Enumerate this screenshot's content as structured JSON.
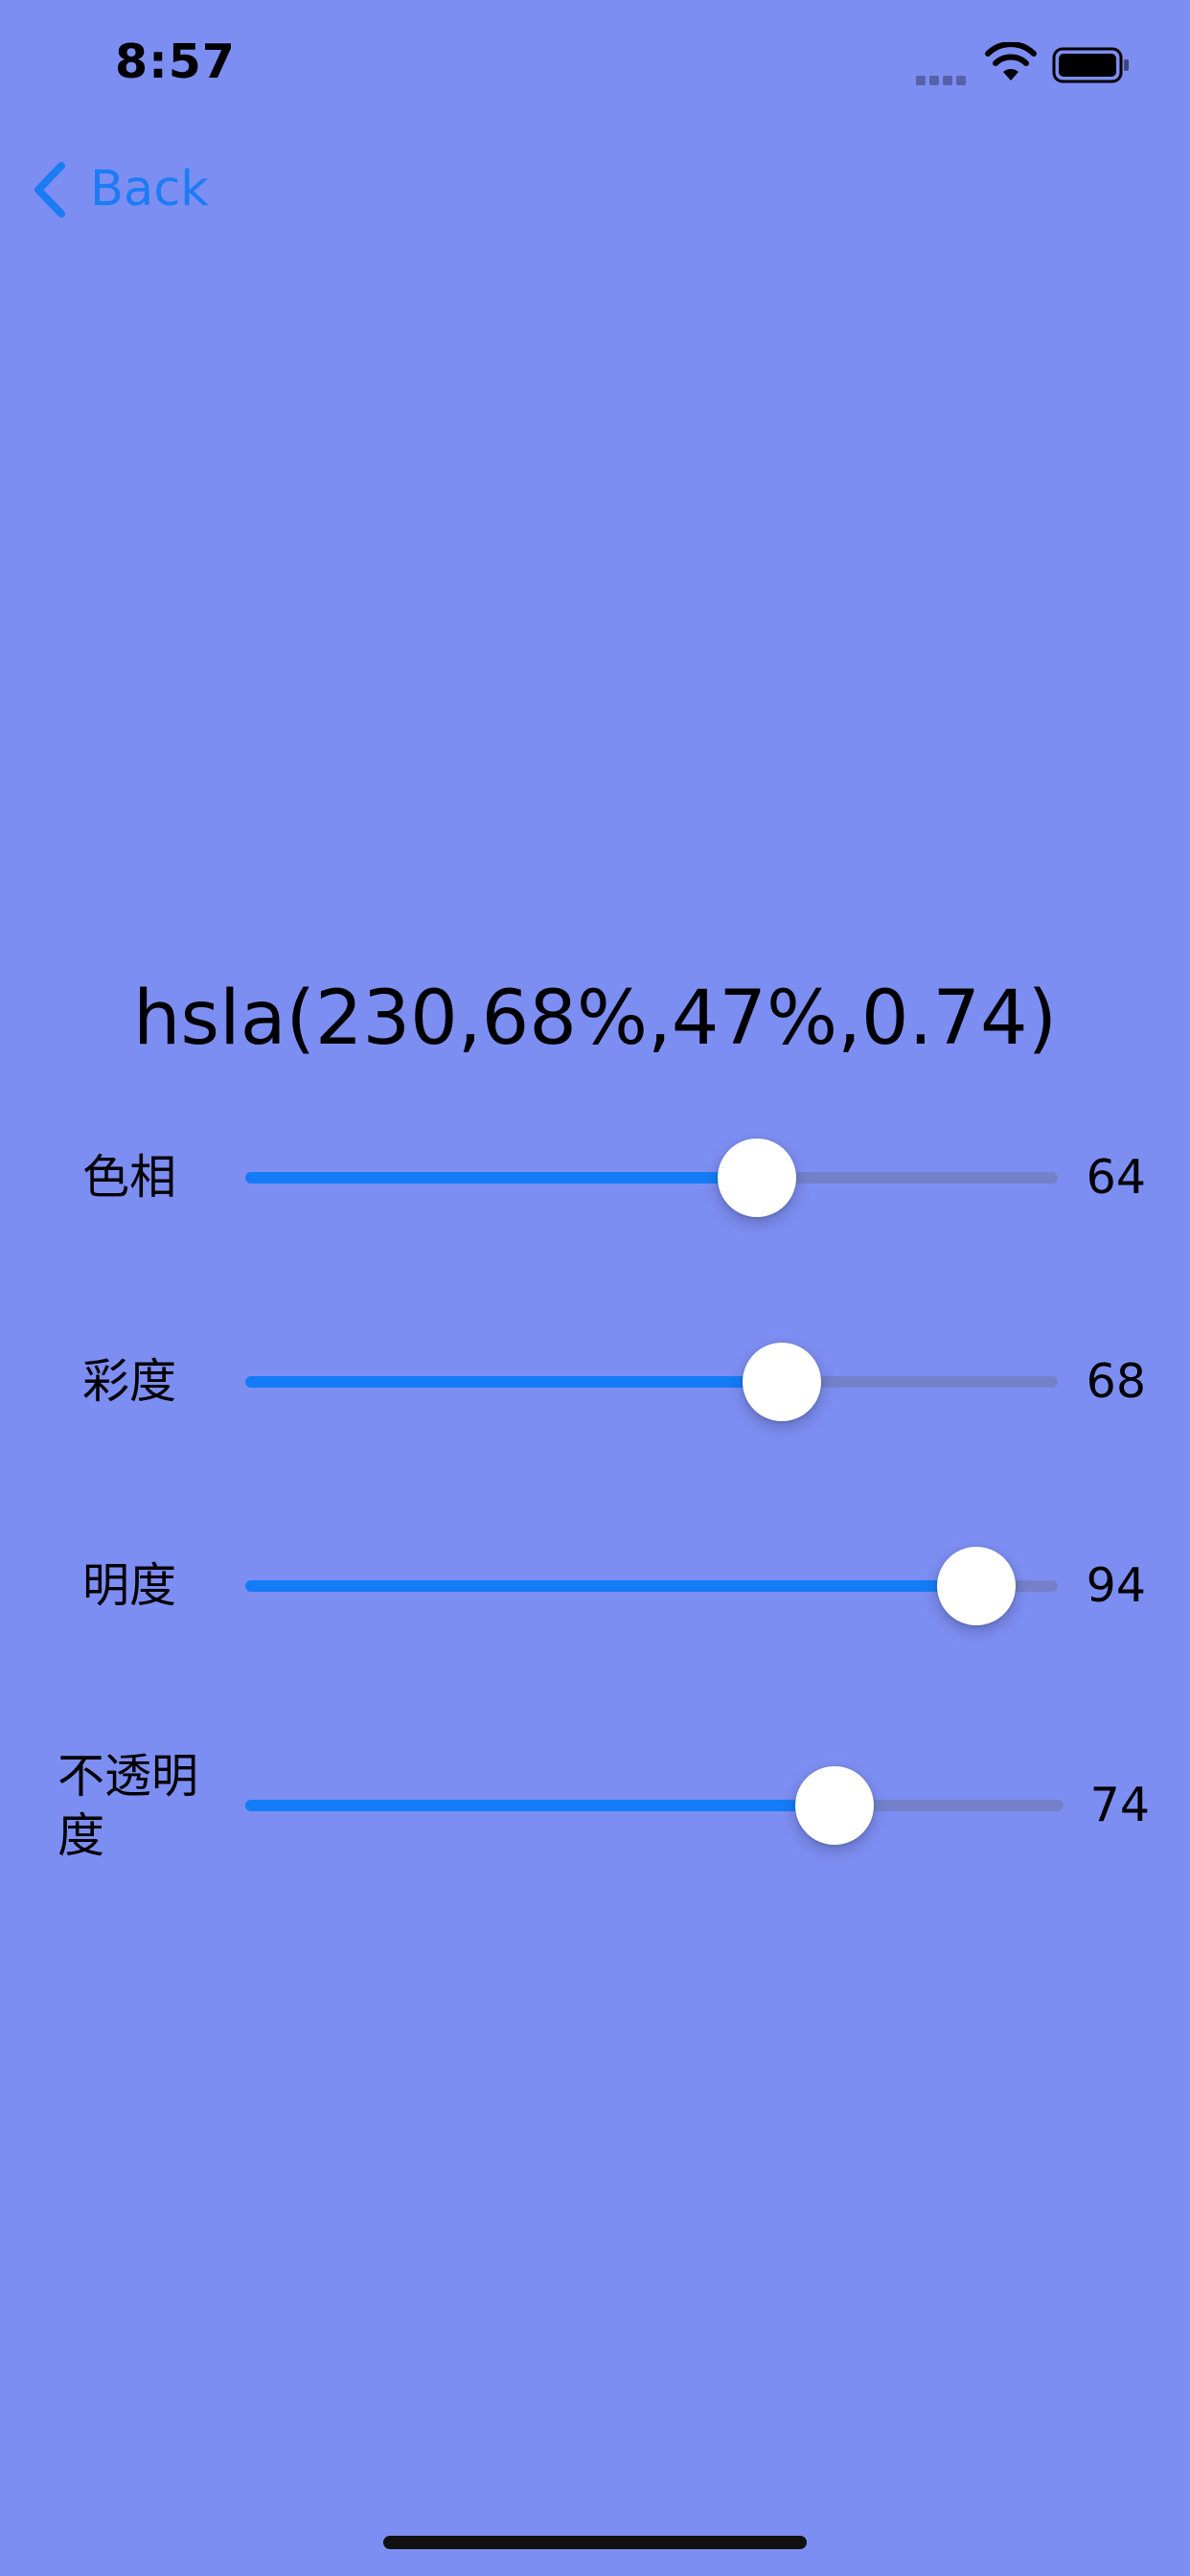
{
  "status_bar": {
    "time": "8:57"
  },
  "nav": {
    "back_label": "Back",
    "back_icon": "chevron-left-icon"
  },
  "color_value": "hsla(230,68%,47%,0.74)",
  "colors": {
    "background": "#7d8ef2",
    "accent": "#147cf7",
    "track": "#6e76aa",
    "thumb": "#ffffff"
  },
  "sliders": [
    {
      "label": "色相",
      "value": "64",
      "fraction": 0.63
    },
    {
      "label": "彩度",
      "value": "68",
      "fraction": 0.66
    },
    {
      "label": "明度",
      "value": "94",
      "fraction": 0.9
    },
    {
      "label": "不透明度",
      "value": "74",
      "fraction": 0.72
    }
  ]
}
